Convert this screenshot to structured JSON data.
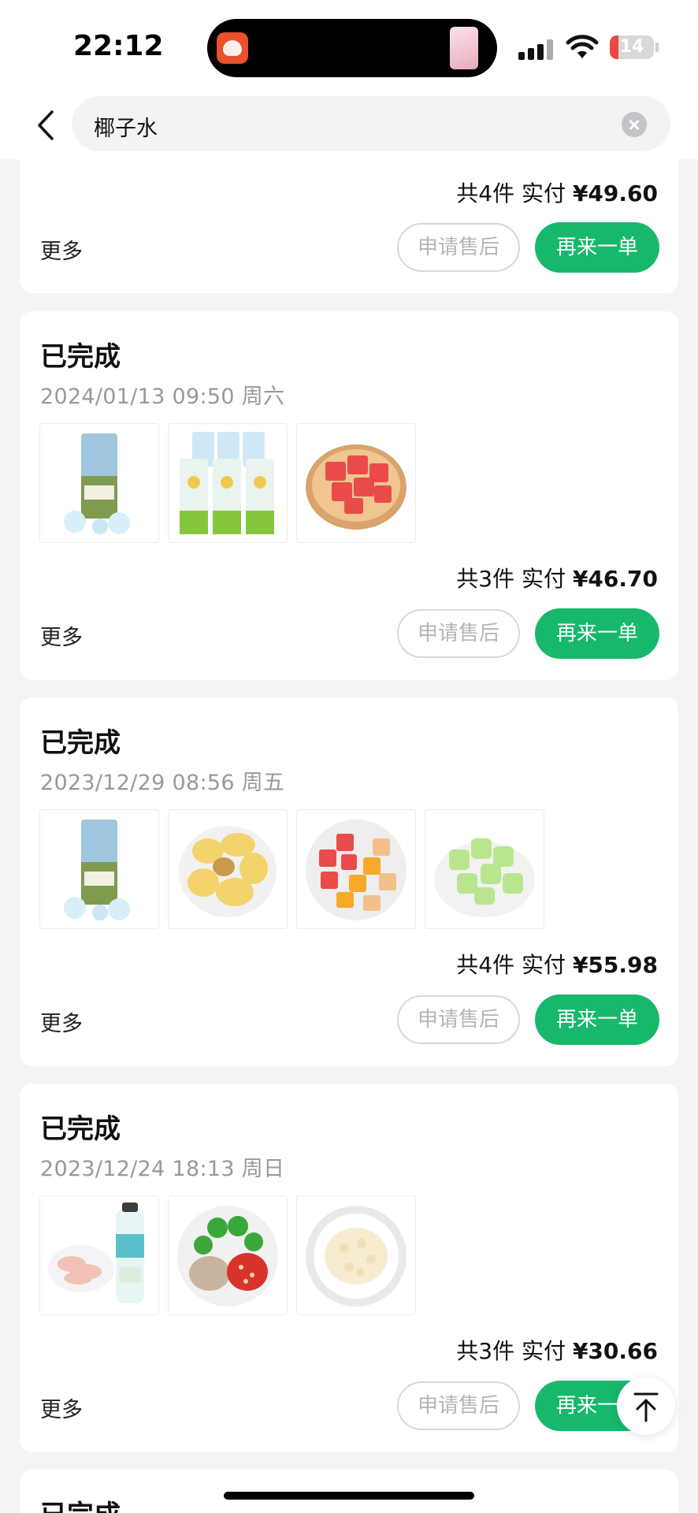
{
  "status_bar": {
    "time": "22:12",
    "battery": "14"
  },
  "search": {
    "query": "椰子水"
  },
  "buttons": {
    "after_sale": "申请售后",
    "reorder": "再来一单",
    "more": "更多"
  },
  "orders": [
    {
      "summary_prefix": "共",
      "count": "4",
      "summary_mid": "件 实付",
      "amount": "¥49.60"
    },
    {
      "status": "已完成",
      "date": "2024/01/13 09:50 周六",
      "summary_prefix": "共",
      "count": "3",
      "summary_mid": "件 实付",
      "amount": "¥46.70",
      "items": [
        "coconut-water-carton",
        "coconut-water-six-pack",
        "watermelon-cubes"
      ]
    },
    {
      "status": "已完成",
      "date": "2023/12/29 08:56 周五",
      "summary_prefix": "共",
      "count": "4",
      "summary_mid": "件 实付",
      "amount": "¥55.98",
      "items": [
        "coconut-water-carton",
        "jackfruit",
        "mixed-fruit-platter",
        "honeydew-cubes"
      ]
    },
    {
      "status": "已完成",
      "date": "2023/12/24 18:13 周日",
      "summary_prefix": "共",
      "count": "3",
      "summary_mid": "件 实付",
      "amount": "¥30.66",
      "items": [
        "chicken-and-coconut-water",
        "lime-chili-garnish",
        "coconut-meat"
      ]
    },
    {
      "status": "已完成"
    }
  ]
}
